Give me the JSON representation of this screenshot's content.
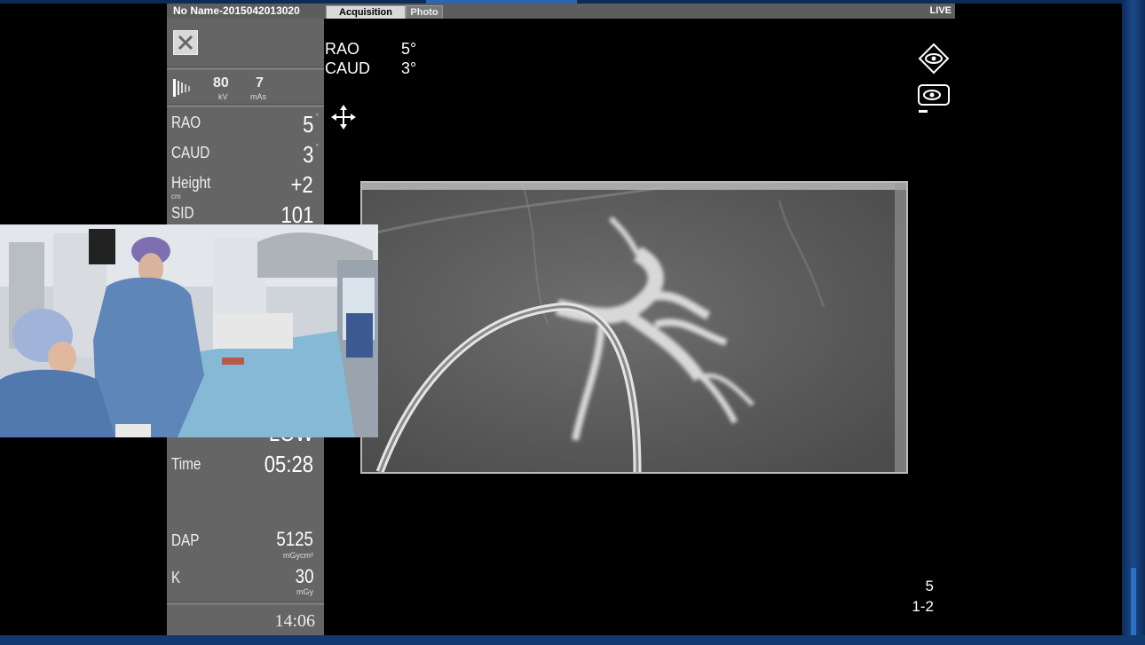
{
  "header": {
    "study_name": "No Name-2015042013020",
    "tabs": [
      {
        "label": "Acquisition",
        "active": true
      },
      {
        "label": "Photo",
        "active": false
      }
    ],
    "status": "LIVE"
  },
  "panel": {
    "kv_value": "80",
    "kv_unit": "kV",
    "mas_value": "7",
    "mas_unit": "mAs",
    "rows": {
      "rao": {
        "label": "RAO",
        "value": "5",
        "unit": "°"
      },
      "caud": {
        "label": "CAUD",
        "value": "3",
        "unit": "°"
      },
      "height": {
        "label": "Height",
        "sublabel": "cm",
        "value": "+2"
      },
      "sid": {
        "label": "SID",
        "value": "101"
      },
      "rate": {
        "value": "LOW"
      },
      "time": {
        "label": "Time",
        "value": "05:28"
      },
      "dap": {
        "label": "DAP",
        "value": "5125",
        "unit": "mGycm²"
      },
      "k": {
        "label": "K",
        "value": "30",
        "unit": "mGy"
      }
    },
    "clock": "14:06"
  },
  "overlay": {
    "orientation": [
      {
        "label": "RAO",
        "value": "5°"
      },
      {
        "label": "CAUD",
        "value": "3°"
      }
    ],
    "frame_number": "5",
    "series_range": "1-2"
  },
  "icons": {
    "close": "close-icon",
    "kv": "xray-tube-icon",
    "move": "move-icon",
    "view": "eye-diamond-icon",
    "camera": "camera-eye-icon"
  },
  "colors": {
    "panel_bg": "#656565",
    "header_bg": "#5d5d5d",
    "frame_blue": "#1a4a8a"
  }
}
